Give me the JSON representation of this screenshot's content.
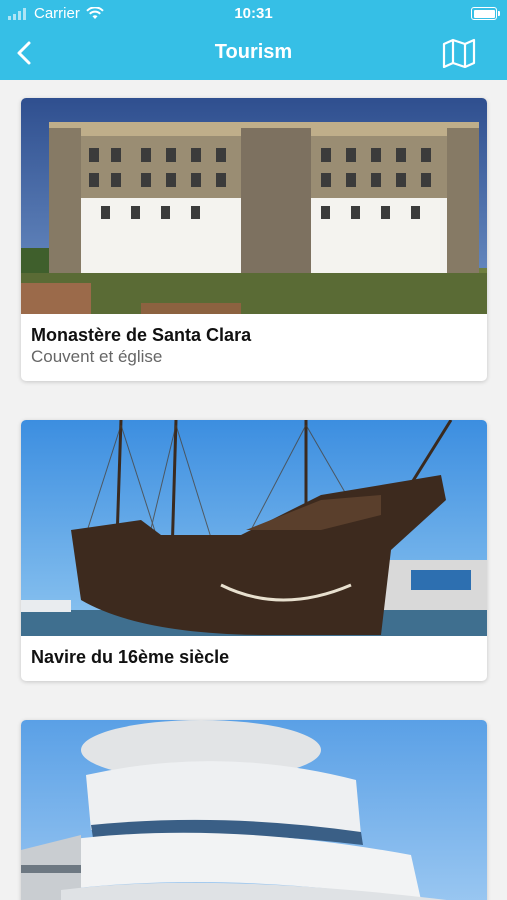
{
  "status": {
    "carrier": "Carrier",
    "time": "10:31"
  },
  "nav": {
    "title": "Tourism",
    "back_icon": "chevron-left-icon",
    "map_icon": "map-icon"
  },
  "colors": {
    "accent": "#36bfe6"
  },
  "places": [
    {
      "name": "Monastère de Santa Clara",
      "subtitle": "Couvent et église"
    },
    {
      "name": "Navire du 16ème siècle",
      "subtitle": ""
    },
    {
      "name": "",
      "subtitle": ""
    }
  ]
}
